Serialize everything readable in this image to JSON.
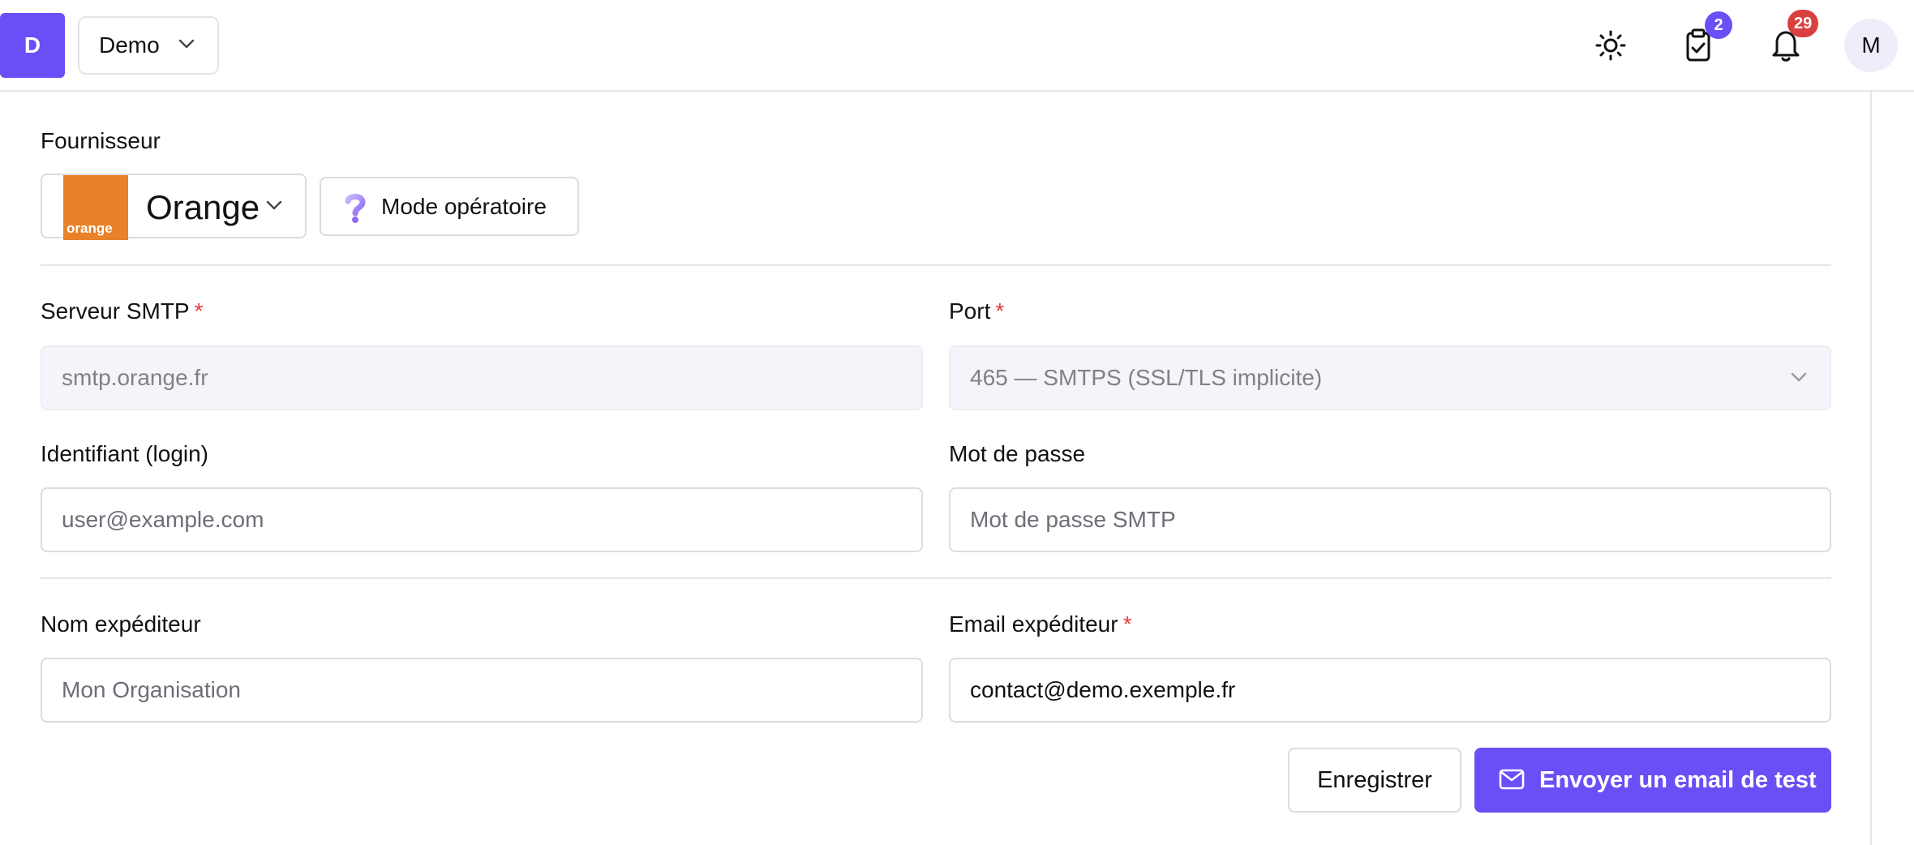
{
  "header": {
    "org_initial": "D",
    "org_name": "Demo",
    "tasks_badge": "2",
    "notifications_badge": "29",
    "user_initial": "M"
  },
  "provider": {
    "section_label": "Fournisseur",
    "selected": "Orange",
    "logo_text": "orange",
    "guide_button": "Mode opératoire"
  },
  "smtp": {
    "server_label": "Serveur SMTP",
    "server_value": "smtp.orange.fr",
    "port_label": "Port",
    "port_value": "465 — SMTPS (SSL/TLS implicite)",
    "login_label": "Identifiant (login)",
    "login_placeholder": "user@example.com",
    "password_label": "Mot de passe",
    "password_placeholder": "Mot de passe SMTP"
  },
  "sender": {
    "name_label": "Nom expéditeur",
    "name_placeholder": "Mon Organisation",
    "email_label": "Email expéditeur",
    "email_value": "contact@demo.exemple.fr"
  },
  "actions": {
    "save": "Enregistrer",
    "send_test": "Envoyer un email de test"
  },
  "required_mark": "*",
  "colors": {
    "accent": "#6b4ef6",
    "badge_tasks": "#6b4ef6",
    "badge_notifications": "#d94040",
    "required": "#e03b3b",
    "orange_brand": "#e9812a"
  }
}
